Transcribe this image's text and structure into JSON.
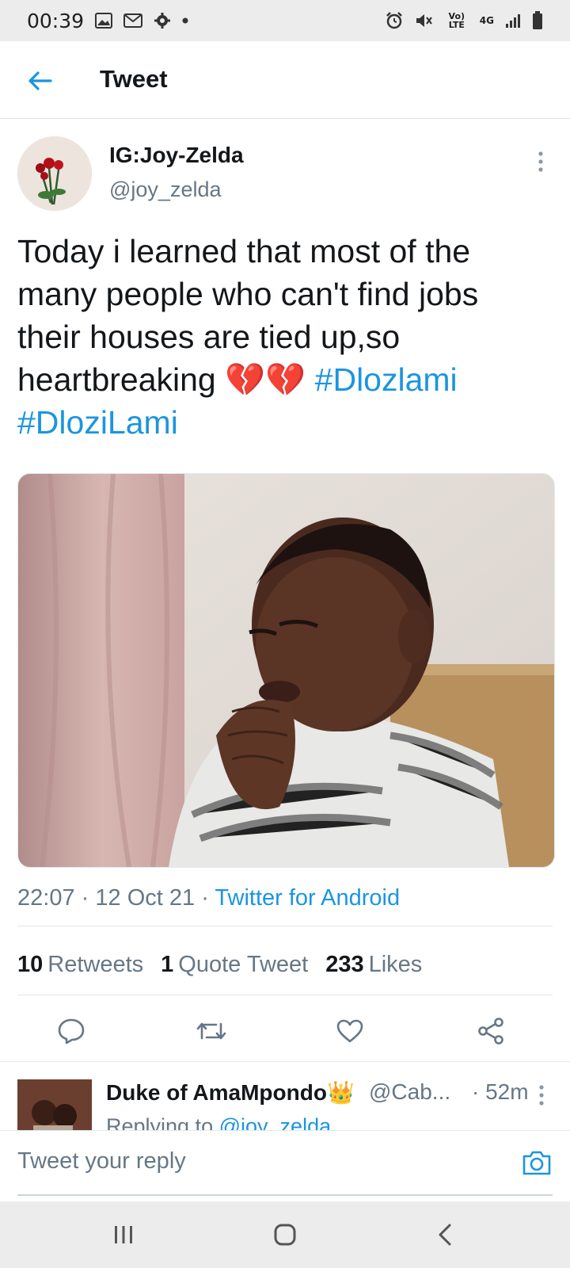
{
  "status_bar": {
    "time": "00:39",
    "left_icons": [
      "image-icon",
      "gmail-icon",
      "settings-icon",
      "dot-icon"
    ],
    "right_icons": [
      "alarm-icon",
      "mute-icon",
      "volte-icon",
      "4g-icon",
      "signal-icon",
      "battery-icon"
    ],
    "volte_label": "Vo) LTE",
    "network_label": "4G"
  },
  "app_bar": {
    "title": "Tweet",
    "back_icon": "arrow-left-icon"
  },
  "tweet": {
    "display_name": "IG:Joy-Zelda",
    "handle": "@joy_zelda",
    "text": "Today i learned that most of the many people who can't find jobs their houses are tied up,so heartbreaking",
    "emoji": "💔💔",
    "hashtags": [
      "#Dlozlami",
      "#DloziLami"
    ],
    "time": "22:07",
    "date": "12 Oct 21",
    "separator": "·",
    "source": "Twitter for Android",
    "stats": {
      "retweets": {
        "count": "10",
        "label": "Retweets"
      },
      "quotes": {
        "count": "1",
        "label": "Quote Tweet"
      },
      "likes": {
        "count": "233",
        "label": "Likes"
      }
    }
  },
  "reply": {
    "display_name": "Duke of AmaMpondo👑",
    "handle": "@Cab...",
    "time": "· 52m",
    "replying_prefix": "Replying to",
    "replying_to": "@joy_zelda"
  },
  "compose": {
    "placeholder": "Tweet your reply"
  },
  "colors": {
    "accent": "#1b95e0",
    "text": "#14171a",
    "muted": "#657786"
  }
}
